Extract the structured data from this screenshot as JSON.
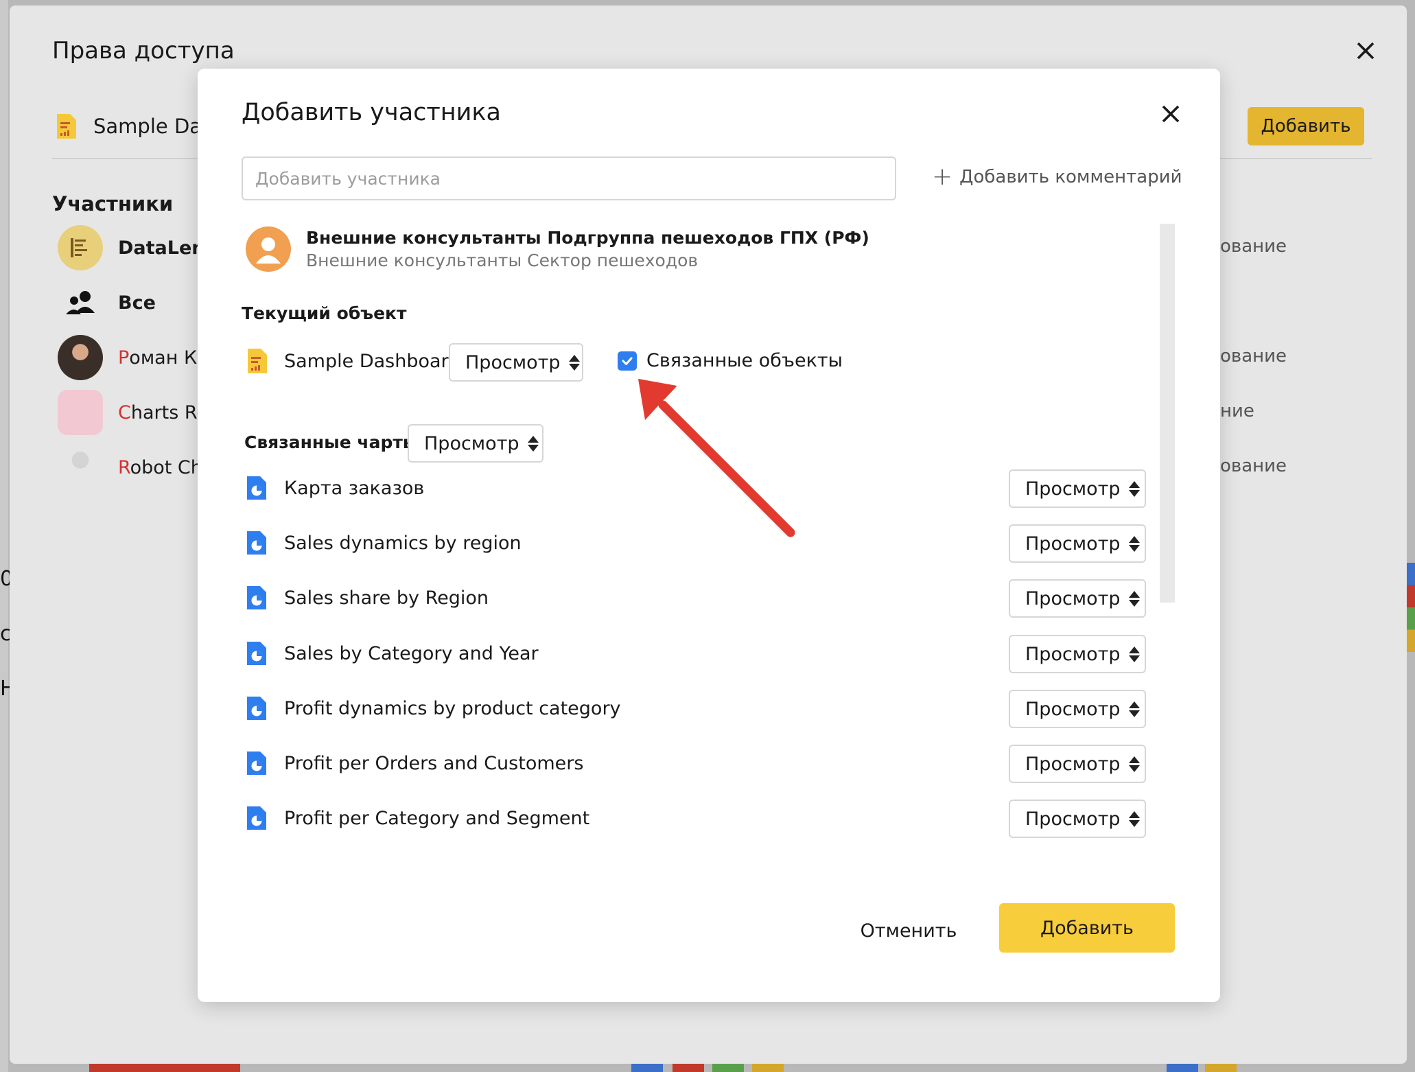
{
  "outer": {
    "title": "Права доступа",
    "document_name": "Sample Das",
    "add_button": "Добавить",
    "section_title": "Участники",
    "members": [
      {
        "first": "",
        "rest": "DataLens",
        "bold": true,
        "right": "ование"
      },
      {
        "first": "",
        "rest": "Все",
        "bold": true,
        "right": ""
      },
      {
        "first": "Р",
        "rest": "оман Ко",
        "bold": false,
        "right": "ование"
      },
      {
        "first": "C",
        "rest": "harts Ro",
        "bold": false,
        "right": "ние"
      },
      {
        "first": "R",
        "rest": "obot Cha",
        "bold": false,
        "right": "ование"
      }
    ],
    "left_edge_glyphs": [
      "0",
      "c",
      "H"
    ]
  },
  "modal": {
    "title": "Добавить участника",
    "search": {
      "placeholder": "Добавить участника",
      "value": ""
    },
    "add_comment": "Добавить комментарий",
    "user": {
      "name": "Внешние консультанты Подгруппа пешеходов ГПХ (РФ)",
      "subtitle": "Внешние консультанты Сектор пешеходов"
    },
    "current_object": {
      "label": "Текущий объект",
      "name": "Sample Dashboard",
      "permission": "Просмотр",
      "related_checkbox": {
        "label": "Связанные объекты",
        "checked": true
      }
    },
    "related_charts": {
      "label": "Связанные чарты",
      "permission": "Просмотр",
      "items": [
        {
          "name": "Карта заказов",
          "permission": "Просмотр"
        },
        {
          "name": "Sales dynamics by region",
          "permission": "Просмотр"
        },
        {
          "name": "Sales share by Region",
          "permission": "Просмотр"
        },
        {
          "name": "Sales by Category and Year",
          "permission": "Просмотр"
        },
        {
          "name": "Profit dynamics by product category",
          "permission": "Просмотр"
        },
        {
          "name": "Profit per Orders and Customers",
          "permission": "Просмотр"
        },
        {
          "name": "Profit per Category and Segment",
          "permission": "Просмотр"
        }
      ]
    },
    "cancel_button": "Отменить",
    "add_button": "Добавить"
  },
  "colors": {
    "accent_yellow": "#f8cd3b",
    "checkbox_blue": "#2f7ef0",
    "annotation_red": "#e23a2f",
    "chart_icon_blue": "#2f7ef0",
    "doc_icon_yellow": "#f5c83a"
  }
}
